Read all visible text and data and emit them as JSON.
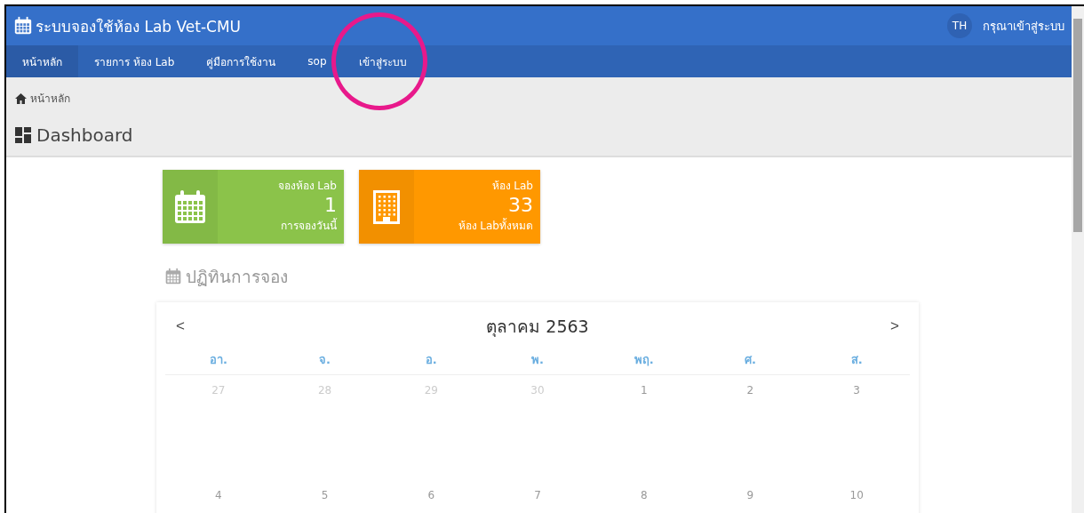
{
  "header": {
    "title": "ระบบจองใช้ห้อง Lab Vet-CMU",
    "avatar": "TH",
    "login_prompt": "กรุณาเข้าสู่ระบบ"
  },
  "nav": [
    {
      "label": "หน้าหลัก",
      "selected": true
    },
    {
      "label": "รายการ ห้อง Lab",
      "selected": false
    },
    {
      "label": "คู่มือการใช้งาน",
      "selected": false
    },
    {
      "label": "sop",
      "selected": false
    },
    {
      "label": "เข้าสู่ระบบ",
      "selected": false,
      "highlighted": true
    }
  ],
  "breadcrumb": "หน้าหลัก",
  "page_title": "Dashboard",
  "cards": [
    {
      "kind": "calendar",
      "color": "#8bc34a",
      "title": "จองห้อง Lab",
      "value": "1",
      "caption": "การจองวันนี้"
    },
    {
      "kind": "building",
      "color": "#ff9800",
      "title": "ห้อง Lab",
      "value": "33",
      "caption": "ห้อง Labทั้งหมด"
    }
  ],
  "section_title": "ปฏิทินการจอง",
  "calendar": {
    "prev": "<",
    "month": "ตุลาคม 2563",
    "next": ">",
    "weekdays": [
      "อา.",
      "จ.",
      "อ.",
      "พ.",
      "พฤ.",
      "ศ.",
      "ส."
    ],
    "weeks": [
      [
        {
          "day": "27",
          "outside": true
        },
        {
          "day": "28",
          "outside": true
        },
        {
          "day": "29",
          "outside": true
        },
        {
          "day": "30",
          "outside": true
        },
        {
          "day": "1",
          "outside": false
        },
        {
          "day": "2",
          "outside": false
        },
        {
          "day": "3",
          "outside": false
        }
      ],
      [
        {
          "day": "4",
          "outside": false
        },
        {
          "day": "5",
          "outside": false
        },
        {
          "day": "6",
          "outside": false
        },
        {
          "day": "7",
          "outside": false
        },
        {
          "day": "8",
          "outside": false
        },
        {
          "day": "9",
          "outside": false
        },
        {
          "day": "10",
          "outside": false
        }
      ]
    ]
  }
}
